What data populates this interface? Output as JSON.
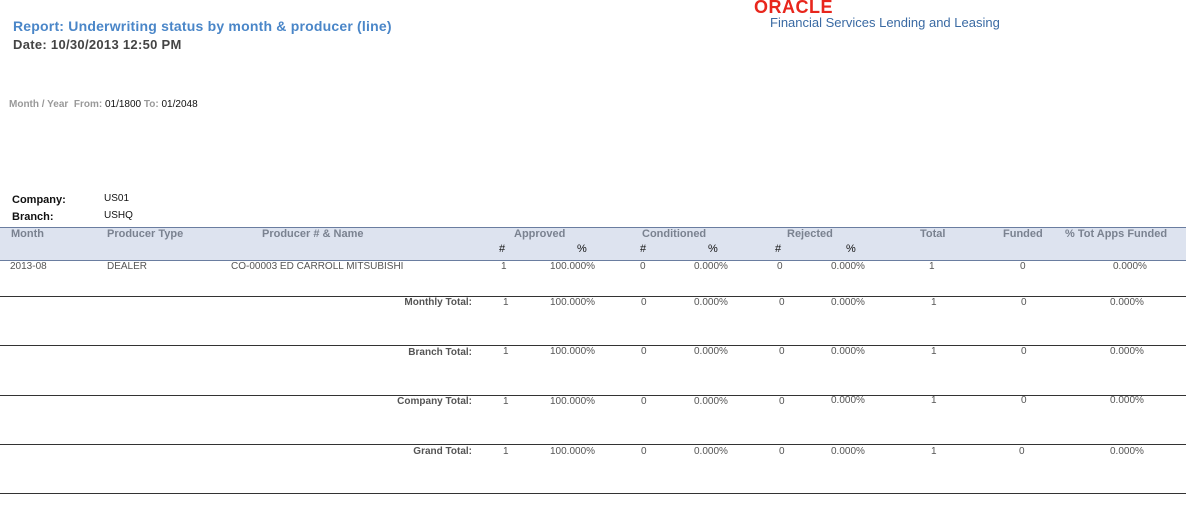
{
  "report": {
    "title": "Report: Underwriting status by month & producer (line)",
    "date": "Date: 10/30/2013  12:50 PM"
  },
  "brand": {
    "logo_text": "ORACLE",
    "product": "Financial Services Lending and Leasing",
    "logo_color": "#e8261c",
    "product_color": "#3a6aa3"
  },
  "filter": {
    "label": "Month / Year",
    "from_label": "From:",
    "from_value": "01/1800",
    "to_label": "To:",
    "to_value": "01/2048"
  },
  "company": {
    "label": "Company:",
    "value": "US01"
  },
  "branch": {
    "label": "Branch:",
    "value": "USHQ"
  },
  "columns": {
    "month": "Month",
    "producer_type": "Producer Type",
    "producer_name": "Producer # & Name",
    "approved": "Approved",
    "conditioned": "Conditioned",
    "rejected": "Rejected",
    "total": "Total",
    "funded": "Funded",
    "pct_funded": "% Tot Apps Funded",
    "num": "#",
    "pct": "%"
  },
  "row": {
    "month": "2013-08",
    "producer_type": "DEALER",
    "producer_name": "CO-00003 ED CARROLL MITSUBISHI",
    "approved_n": "1",
    "approved_p": "100.000%",
    "conditioned_n": "0",
    "conditioned_p": "0.000%",
    "rejected_n": "0",
    "rejected_p": "0.000%",
    "total": "1",
    "funded": "0",
    "pct_funded": "0.000%"
  },
  "totals": [
    {
      "label": "Monthly Total:",
      "approved_n": "1",
      "approved_p": "100.000%",
      "conditioned_n": "0",
      "conditioned_p": "0.000%",
      "rejected_n": "0",
      "rejected_p": "0.000%",
      "total": "1",
      "funded": "0",
      "pct_funded": "0.000%"
    },
    {
      "label": "Branch Total:",
      "approved_n": "1",
      "approved_p": "100.000%",
      "conditioned_n": "0",
      "conditioned_p": "0.000%",
      "rejected_n": "0",
      "rejected_p": "0.000%",
      "total": "1",
      "funded": "0",
      "pct_funded": "0.000%"
    },
    {
      "label": "Company Total:",
      "approved_n": "1",
      "approved_p": "100.000%",
      "conditioned_n": "0",
      "conditioned_p": "0.000%",
      "rejected_n": "0",
      "rejected_p": "0.000%",
      "total": "1",
      "funded": "0",
      "pct_funded": "0.000%"
    },
    {
      "label": "Grand Total:",
      "approved_n": "1",
      "approved_p": "100.000%",
      "conditioned_n": "0",
      "conditioned_p": "0.000%",
      "rejected_n": "0",
      "rejected_p": "0.000%",
      "total": "1",
      "funded": "0",
      "pct_funded": "0.000%"
    }
  ]
}
